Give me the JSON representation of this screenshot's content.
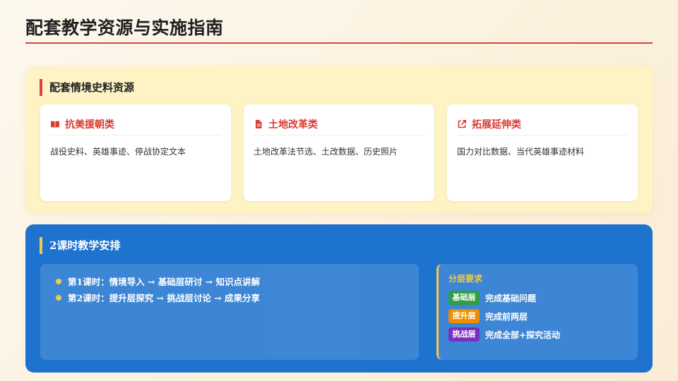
{
  "page": {
    "title": "配套教学资源与实施指南"
  },
  "resources": {
    "heading": "配套情境史料资源",
    "cards": [
      {
        "title": "抗美援朝类",
        "icon": "book-icon",
        "body": "战役史料、英雄事迹、停战协定文本"
      },
      {
        "title": "土地改革类",
        "icon": "document-icon",
        "body": "土地改革法节选、土改数据、历史照片"
      },
      {
        "title": "拓展延伸类",
        "icon": "external-link-icon",
        "body": "国力对比数据、当代英雄事迹材料"
      }
    ]
  },
  "schedule": {
    "heading": "2课时教学安排",
    "lessons": [
      "第1课时：情境导入 → 基础层研讨 → 知识点讲解",
      "第2课时：提升层探究 → 挑战层讨论 → 成果分享"
    ],
    "tiers": {
      "title": "分层要求",
      "items": [
        {
          "badge": "基础层",
          "text": "完成基础问题",
          "color": "#2f9e44"
        },
        {
          "badge": "提升层",
          "text": "完成前两层",
          "color": "#f08c00"
        },
        {
          "badge": "挑战层",
          "text": "完成全部+探究活动",
          "color": "#7b2fbf"
        }
      ]
    }
  },
  "colors": {
    "accent_red": "#d9463b",
    "accent_yellow": "#f3c94a",
    "panel_blue": "#1e73cf",
    "panel_cream": "#fdf3c4"
  }
}
